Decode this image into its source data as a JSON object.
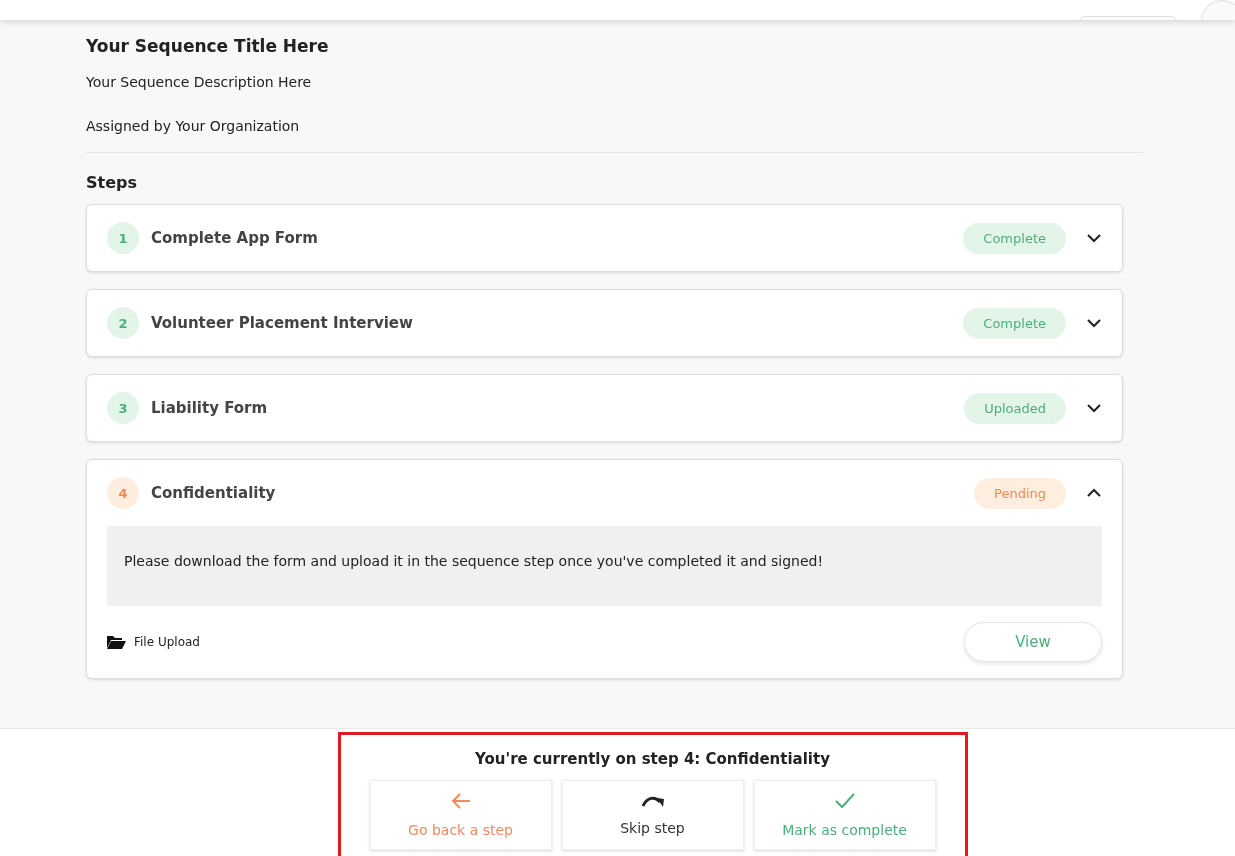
{
  "sequence": {
    "title": "Your Sequence Title Here",
    "description": "Your Sequence Description Here",
    "assigned_by": "Assigned by Your Organization"
  },
  "steps_heading": "Steps",
  "steps": [
    {
      "number": "1",
      "title": "Complete App Form",
      "status": "Complete",
      "kind": "complete",
      "expanded": false
    },
    {
      "number": "2",
      "title": "Volunteer Placement Interview",
      "status": "Complete",
      "kind": "complete",
      "expanded": false
    },
    {
      "number": "3",
      "title": "Liability Form",
      "status": "Uploaded",
      "kind": "complete",
      "expanded": false
    },
    {
      "number": "4",
      "title": "Confidentiality",
      "status": "Pending",
      "kind": "pending",
      "expanded": true,
      "instructions": "Please download the form and upload it in the sequence step once you've completed it and signed!",
      "attachment": "File Upload",
      "action": "View"
    }
  ],
  "footer": {
    "current": "You're currently on step 4: Confidentiality",
    "actions": [
      {
        "label": "Go back a step",
        "kind": "back"
      },
      {
        "label": "Skip step",
        "kind": "skip"
      },
      {
        "label": "Mark as complete",
        "kind": "complete"
      }
    ]
  }
}
